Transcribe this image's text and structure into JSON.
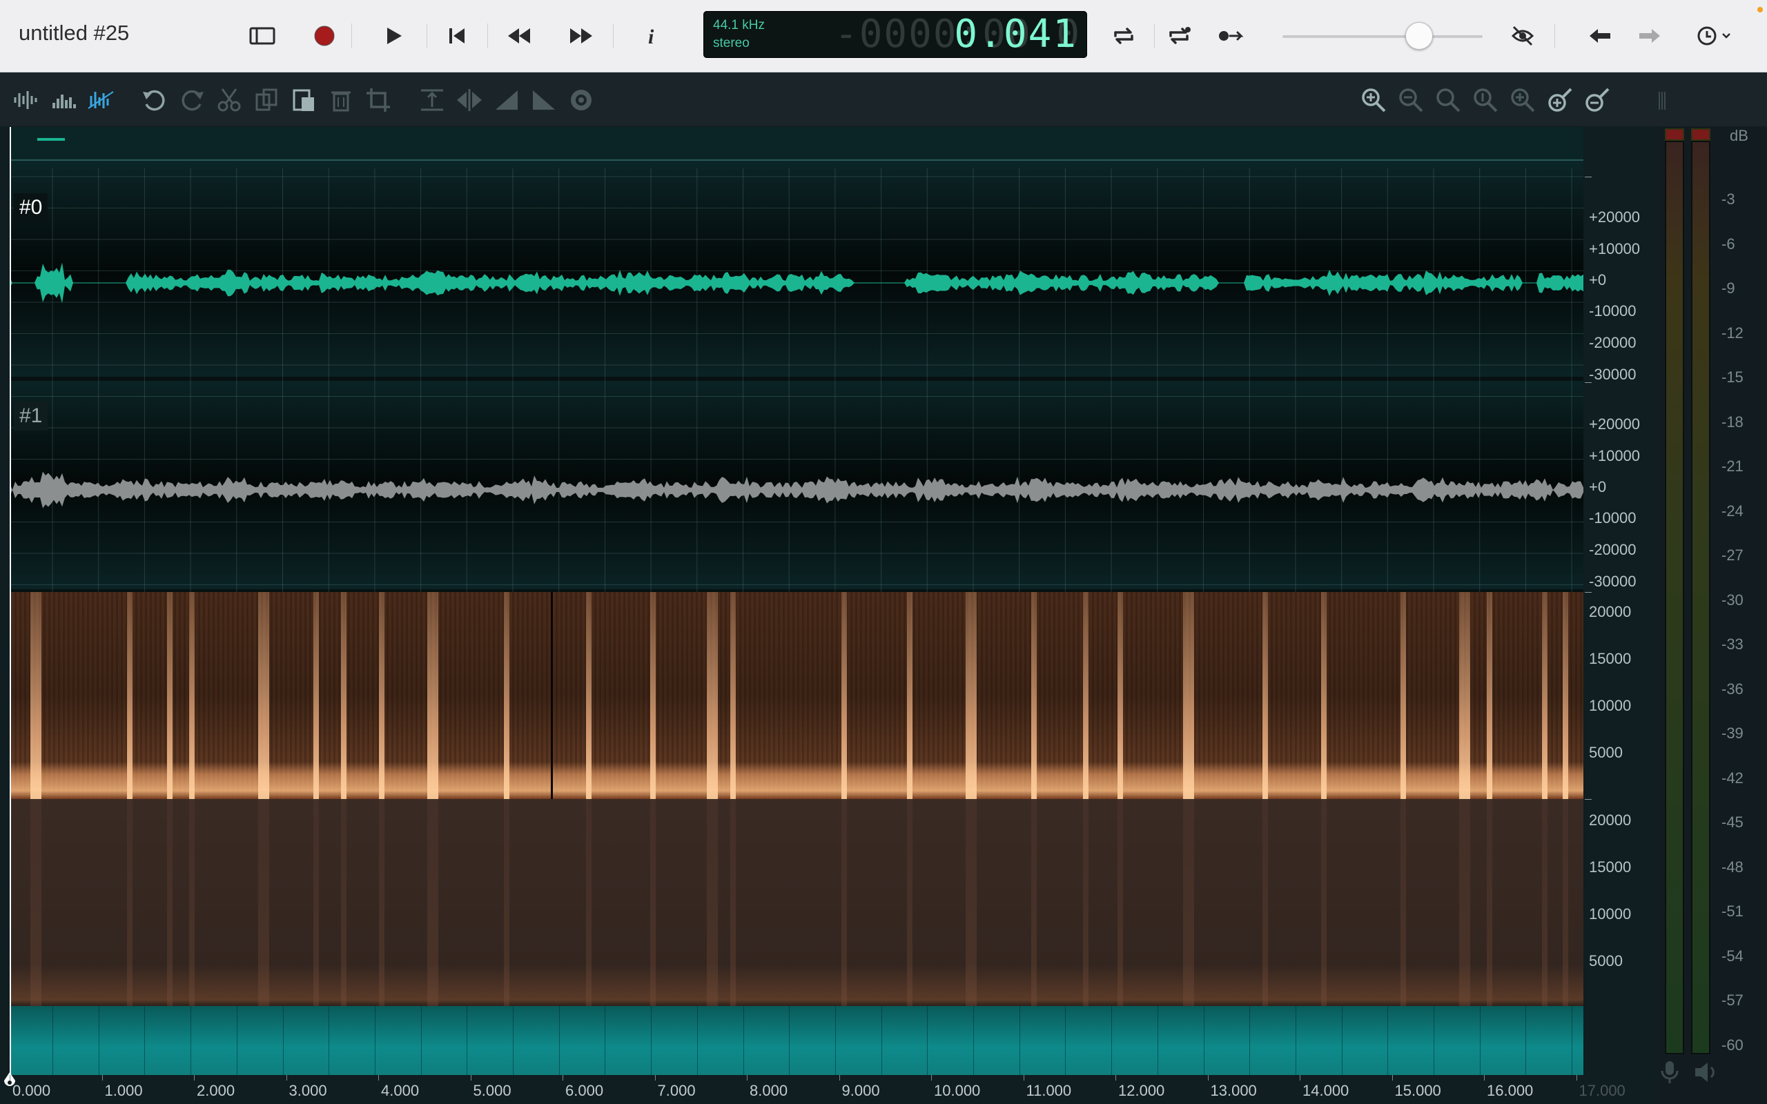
{
  "window": {
    "title": "untitled #25"
  },
  "transport": {
    "sample_rate": "44.1 kHz",
    "channels": "stereo",
    "ghost_time": "-0000:00:0",
    "time": "0.041"
  },
  "tracks": [
    {
      "label": "#0",
      "color": "#1bb591",
      "axis": [
        "+20000",
        "+10000",
        "+0",
        "-10000",
        "-20000",
        "-30000"
      ]
    },
    {
      "label": "#1",
      "color": "#8c8f90",
      "axis": [
        "+20000",
        "+10000",
        "+0",
        "-10000",
        "-20000",
        "-30000"
      ]
    }
  ],
  "spectrum_axis": {
    "upper": [
      "20000",
      "15000",
      "10000",
      "5000"
    ],
    "lower": [
      "20000",
      "15000",
      "10000",
      "5000"
    ]
  },
  "meter": {
    "unit": "dB",
    "scale": [
      "-3",
      "-6",
      "-9",
      "-12",
      "-15",
      "-18",
      "-21",
      "-24",
      "-27",
      "-30",
      "-33",
      "-36",
      "-39",
      "-42",
      "-45",
      "-48",
      "-51",
      "-54",
      "-57",
      "-60"
    ]
  },
  "timeline": [
    "0.000",
    "1.000",
    "2.000",
    "3.000",
    "4.000",
    "5.000",
    "6.000",
    "7.000",
    "8.000",
    "9.000",
    "10.000",
    "11.000",
    "12.000",
    "13.000",
    "14.000",
    "15.000",
    "16.000",
    "17.000"
  ]
}
